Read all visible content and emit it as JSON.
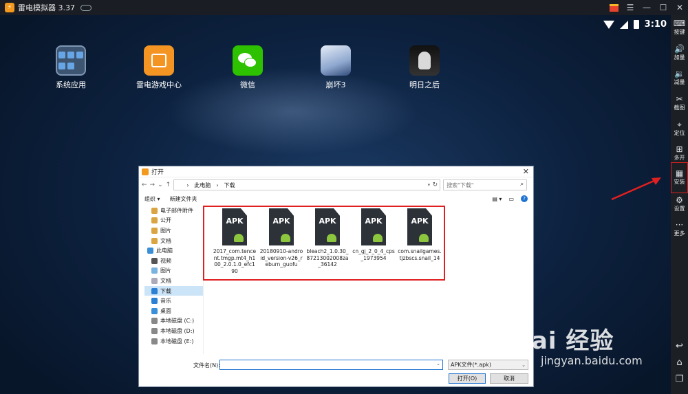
{
  "window": {
    "title": "雷电模拟器 3.37"
  },
  "titlebar": {
    "menu_glyph": "☰",
    "minimize_glyph": "—",
    "maximize_glyph": "☐",
    "close_glyph": "✕"
  },
  "status": {
    "time": "3:10"
  },
  "apps": [
    {
      "label": "系统应用",
      "icon": "system-apps-folder-icon"
    },
    {
      "label": "雷电游戏中心",
      "icon": "game-center-bag-icon"
    },
    {
      "label": "微信",
      "icon": "wechat-icon"
    },
    {
      "label": "崩坏3",
      "icon": "honkai3-icon"
    },
    {
      "label": "明日之后",
      "icon": "lifeafter-icon"
    }
  ],
  "sidebar": [
    {
      "label": "按键",
      "glyph": "⌨"
    },
    {
      "label": "加量",
      "glyph": "🔊"
    },
    {
      "label": "减量",
      "glyph": "🔉"
    },
    {
      "label": "截图",
      "glyph": "✂"
    },
    {
      "label": "定位",
      "glyph": "⌖"
    },
    {
      "label": "多开",
      "glyph": "⊞"
    },
    {
      "label": "安装",
      "glyph": "▦"
    },
    {
      "label": "设置",
      "glyph": "⚙"
    },
    {
      "label": "更多",
      "glyph": "···"
    }
  ],
  "sidebar_nav": {
    "back": "↩",
    "home": "⌂",
    "recent": "❐"
  },
  "dialog": {
    "title": "打开",
    "close": "✕",
    "nav_back": "←",
    "nav_forward": "→",
    "nav_down": "⌄",
    "nav_up": "↑",
    "breadcrumb": [
      "此电脑",
      "下载"
    ],
    "breadcrumb_sep": "›",
    "search_placeholder": "搜索\"下载\"",
    "organize": "组织 ▾",
    "new_folder": "新建文件夹",
    "help": "?",
    "nav_items": [
      {
        "label": "电子邮件附件",
        "top": false
      },
      {
        "label": "公开",
        "top": false
      },
      {
        "label": "图片",
        "top": false
      },
      {
        "label": "文档",
        "top": false
      },
      {
        "label": "此电脑",
        "top": true
      },
      {
        "label": "视频",
        "top": false
      },
      {
        "label": "图片",
        "top": false
      },
      {
        "label": "文档",
        "top": false
      },
      {
        "label": "下载",
        "top": false,
        "selected": true
      },
      {
        "label": "音乐",
        "top": false
      },
      {
        "label": "桌面",
        "top": false
      },
      {
        "label": "本地磁盘 (C:)",
        "top": false
      },
      {
        "label": "本地磁盘 (D:)",
        "top": false
      },
      {
        "label": "本地磁盘 (E:)",
        "top": false
      }
    ],
    "files": [
      {
        "name": "2017_com.tencent.tmgp.mt4_h100_2.0.1.0_efc190",
        "badge": "APK"
      },
      {
        "name": "20180910-android_version-v26_reburn_guofu",
        "badge": "APK"
      },
      {
        "name": "bleach2_1.0.30_87213002008za_36142",
        "badge": "APK"
      },
      {
        "name": "cn_gj_2_0_4_cps_1973954",
        "badge": "APK"
      },
      {
        "name": "com.snailgames.tjzbscs.snail_14",
        "badge": "APK"
      }
    ],
    "filename_label": "文件名(N):",
    "filename_value": "",
    "filetype": "APK文件(*.apk)",
    "open_button": "打开(O)",
    "cancel_button": "取消"
  },
  "watermark": {
    "main": "Bai 经验",
    "url": "jingyan.baidu.com"
  },
  "colors": {
    "highlight": "#e02020",
    "accent": "#1e73d1",
    "apk_android": "#8cc63f"
  }
}
